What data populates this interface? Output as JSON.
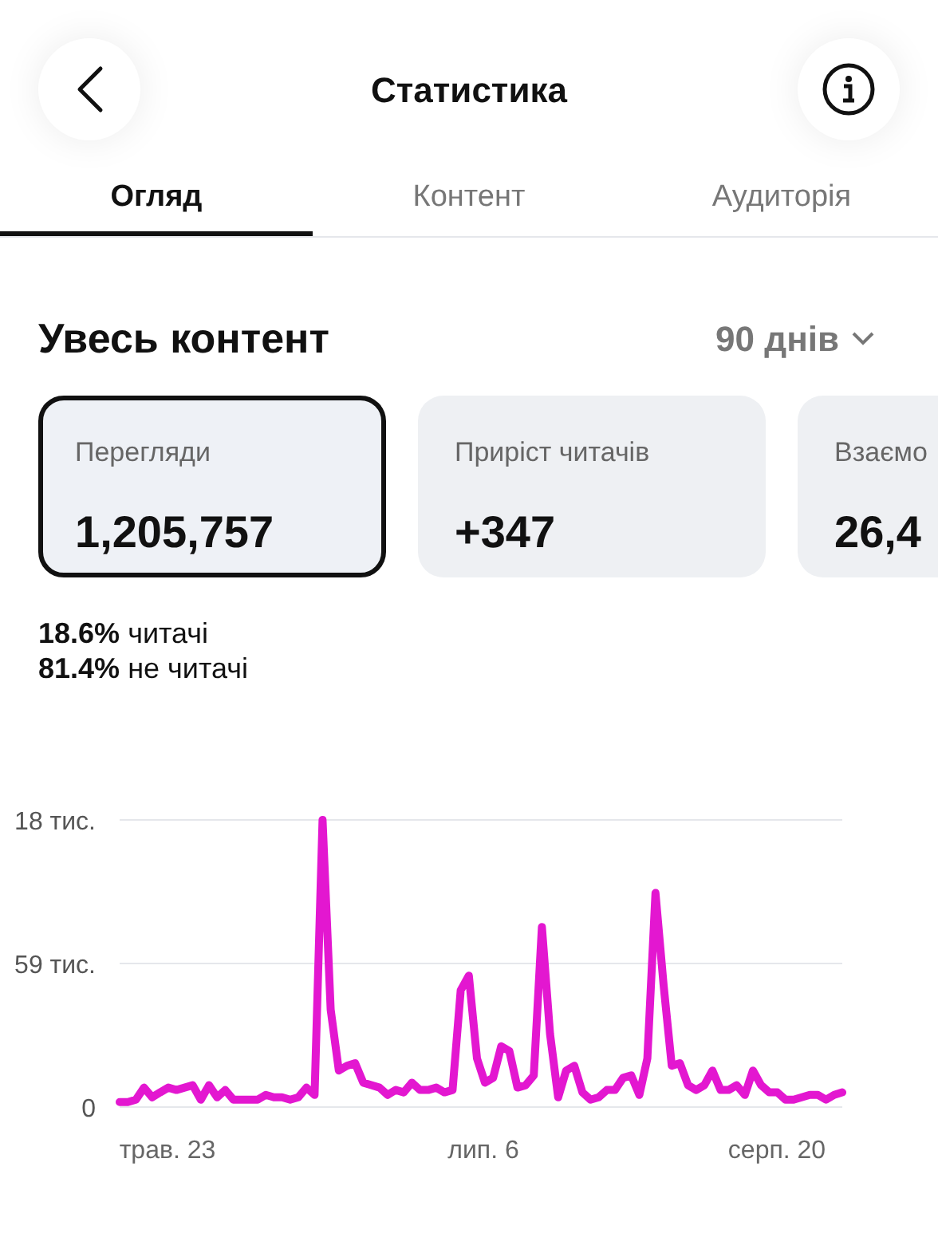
{
  "header": {
    "title": "Статистика"
  },
  "tabs": [
    {
      "label": "Огляд",
      "selected": true
    },
    {
      "label": "Контент",
      "selected": false
    },
    {
      "label": "Аудиторія",
      "selected": false
    }
  ],
  "section": {
    "title": "Увесь контент",
    "period": "90 днів"
  },
  "metrics": [
    {
      "label": "Перегляди",
      "value": "1,205,757",
      "selected": true
    },
    {
      "label": "Приріст читачів",
      "value": "+347",
      "selected": false
    },
    {
      "label": "Взаємо",
      "value": "26,4",
      "selected": false
    }
  ],
  "breakdown": [
    {
      "share": "18.6%",
      "label": "читачі"
    },
    {
      "share": "81.4%",
      "label": "не читачі"
    }
  ],
  "axis_labels": {
    "top": "18 тис.",
    "x": [
      "трав. 23",
      "лип. 6",
      "серп. 20"
    ]
  },
  "chart_data": {
    "type": "line",
    "ylim": [
      0,
      118
    ],
    "yticks": [
      0,
      {
        "value": 59,
        "label": "59 тис."
      }
    ],
    "series": [
      {
        "color": "#e317d0",
        "values": [
          2,
          2,
          3,
          8,
          4,
          6,
          8,
          7,
          8,
          9,
          3,
          9,
          4,
          7,
          3,
          3,
          3,
          3,
          5,
          4,
          4,
          3,
          4,
          8,
          5,
          118,
          40,
          15,
          17,
          18,
          10,
          9,
          8,
          5,
          7,
          6,
          10,
          7,
          7,
          8,
          6,
          7,
          48,
          54,
          20,
          10,
          12,
          25,
          23,
          8,
          9,
          13,
          74,
          30,
          4,
          15,
          17,
          6,
          3,
          4,
          7,
          7,
          12,
          13,
          5,
          20,
          88,
          50,
          17,
          18,
          9,
          7,
          9,
          15,
          7,
          7,
          9,
          5,
          15,
          9,
          6,
          6,
          3,
          3,
          4,
          5,
          5,
          3,
          5,
          6
        ]
      }
    ]
  }
}
